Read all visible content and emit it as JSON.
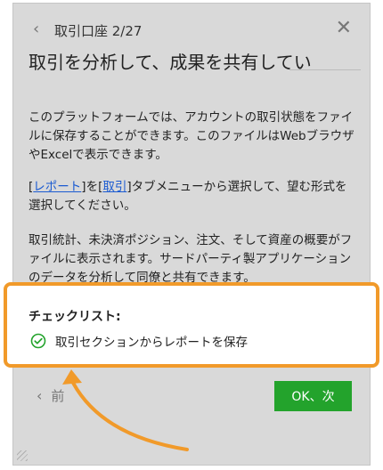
{
  "dialog": {
    "step": "取引口座 2/27",
    "title": "取引を分析して、成果を共有してい",
    "paragraph1": "このプラットフォームでは、アカウントの取引状態をファイルに保存することができます。このファイルはWebブラウザやExcelで表示できます。",
    "paragraph2_link1": "レポート",
    "paragraph2_mid": "を",
    "paragraph2_link2": "取引",
    "paragraph2_rest": "タブメニューから選択して、望む形式を選択してください。",
    "paragraph3": "取引統計、未決済ポジション、注文、そして資産の概要がファイルに表示されます。サードパーティ製アプリケーションのデータを分析して同僚と共有できます。",
    "back_label": "前",
    "next_label": "OK、次"
  },
  "checklist": {
    "title": "チェックリスト:",
    "items": [
      {
        "label": "取引セクションからレポートを保存",
        "icon": "check-circle-icon"
      }
    ]
  },
  "colors": {
    "panel_bg": "#d9d9d9",
    "accent_green": "#23a32c",
    "highlight_orange": "#f19a2a",
    "link_blue": "#1a5ad1"
  }
}
